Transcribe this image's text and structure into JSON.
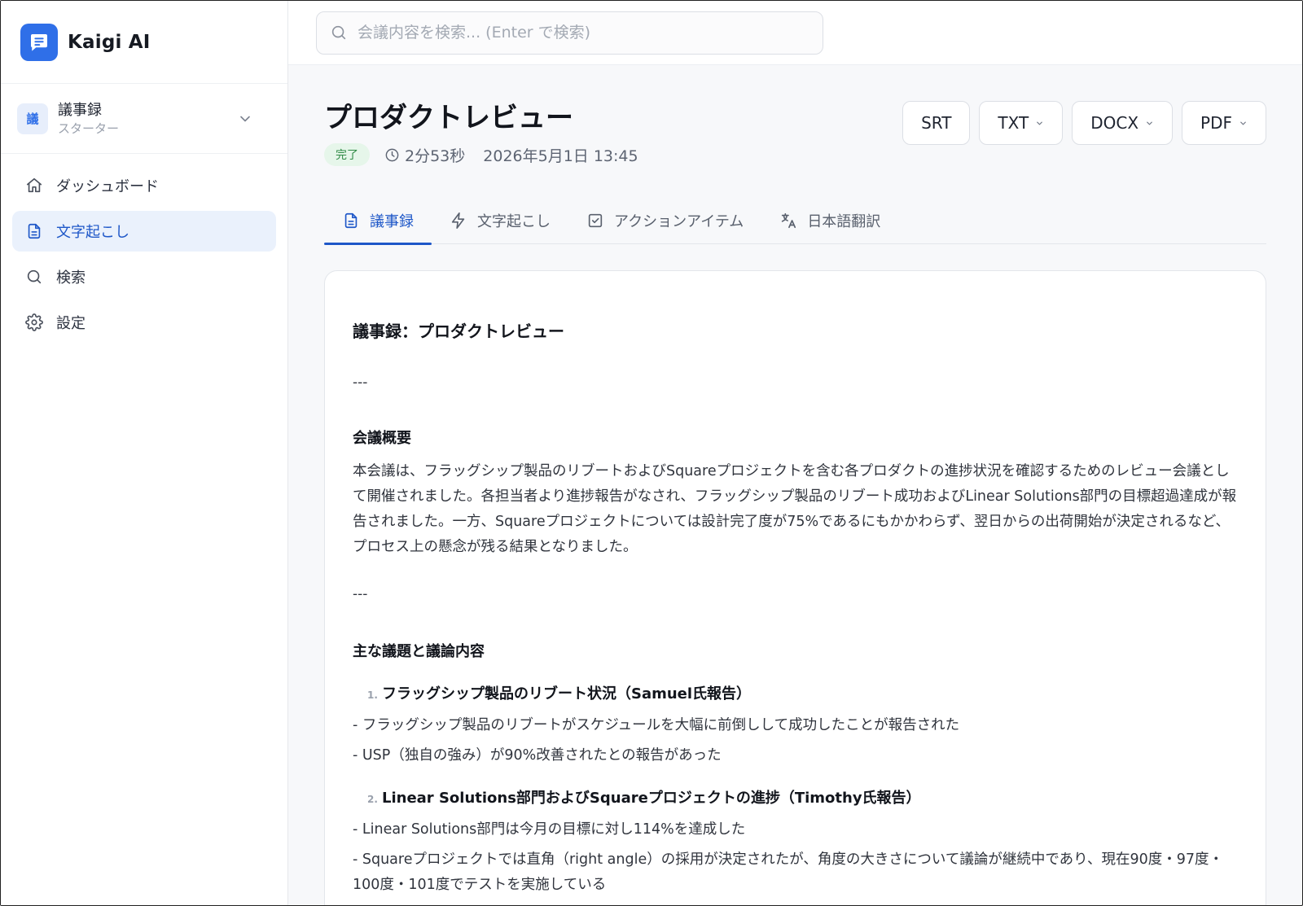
{
  "brand": {
    "name": "Kaigi AI"
  },
  "workspace": {
    "badge": "議",
    "name": "議事録",
    "plan": "スターター"
  },
  "nav": [
    {
      "label": "ダッシュボード",
      "icon": "home-icon"
    },
    {
      "label": "文字起こし",
      "icon": "document-icon",
      "active": true
    },
    {
      "label": "検索",
      "icon": "search-icon"
    },
    {
      "label": "設定",
      "icon": "gear-icon"
    }
  ],
  "search": {
    "placeholder": "会議内容を検索... (Enter で検索)",
    "value": ""
  },
  "meeting": {
    "title": "プロダクトレビュー",
    "status": "完了",
    "duration": "2分53秒",
    "datetime": "2026年5月1日 13:45"
  },
  "exports": [
    {
      "label": "SRT",
      "dropdown": false
    },
    {
      "label": "TXT",
      "dropdown": true
    },
    {
      "label": "DOCX",
      "dropdown": true
    },
    {
      "label": "PDF",
      "dropdown": true
    }
  ],
  "tabs": [
    {
      "label": "議事録",
      "icon": "document-icon",
      "active": true
    },
    {
      "label": "文字起こし",
      "icon": "lightning-icon"
    },
    {
      "label": "アクションアイテム",
      "icon": "checkbox-icon"
    },
    {
      "label": "日本語翻訳",
      "icon": "translate-icon"
    }
  ],
  "minutes": {
    "heading": "議事録：プロダクトレビュー",
    "separator": "---",
    "overview_heading": "会議概要",
    "overview_text": "本会議は、フラッグシップ製品のリブートおよびSquareプロジェクトを含む各プロダクトの進捗状況を確認するためのレビュー会議として開催されました。各担当者より進捗報告がなされ、フラッグシップ製品のリブート成功およびLinear Solutions部門の目標超過達成が報告されました。一方、Squareプロジェクトについては設計完了度が75%であるにもかかわらず、翌日からの出荷開始が決定されるなど、プロセス上の懸念が残る結果となりました。",
    "topics_heading": "主な議題と議論内容",
    "topic1": {
      "number": "1.",
      "title": "フラッグシップ製品のリブート状況（Samuel氏報告）",
      "bullets": [
        "- フラッグシップ製品のリブートがスケジュールを大幅に前倒しして成功したことが報告された",
        "- USP（独自の強み）が90%改善されたとの報告があった"
      ]
    },
    "topic2": {
      "number": "2.",
      "title": "Linear Solutions部門およびSquareプロジェクトの進捗（Timothy氏報告）",
      "bullets": [
        "- Linear Solutions部門は今月の目標に対し114%を達成した",
        "- Squareプロジェクトでは直角（right angle）の採用が決定されたが、角度の大きさについて議論が継続中であり、現在90度・97度・100度・101度でテストを実施している"
      ]
    }
  },
  "colors": {
    "accent": "#1e57c8",
    "brand": "#2f6fe8",
    "status_bg": "#e6f6ea",
    "status_text": "#2f8a45",
    "active_nav_bg": "#eaf1fc"
  }
}
